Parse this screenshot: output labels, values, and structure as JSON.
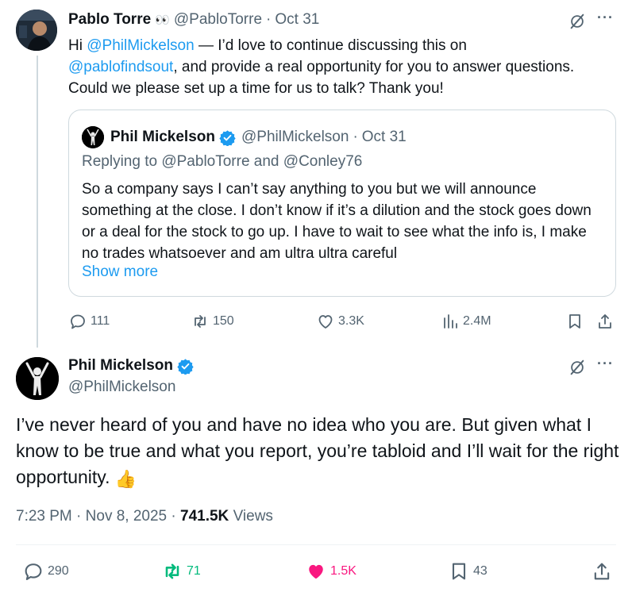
{
  "quoted_tweet": {
    "author_name": "Pablo Torre",
    "author_emoji": "👀",
    "author_handle": "@PabloTorre",
    "separator": "·",
    "date": "Oct 31",
    "text_parts": [
      "Hi ",
      "@PhilMickelson",
      " — I’d love to continue discussing this on ",
      "@pablofindsout",
      ", and provide a real opportunity for you to answer questions. Could we please set up a time for us to talk? Thank you!"
    ],
    "embedded": {
      "author_name": "Phil Mickelson",
      "author_handle": "@PhilMickelson",
      "separator": "·",
      "date": "Oct 31",
      "reply_prefix": "Replying to ",
      "reply_handle_1": "@PabloTorre",
      "reply_and": " and ",
      "reply_handle_2": "@Conley76",
      "text": "So a company says I can’t say anything to you but we will announce something at the close. I don’t know if it’s a dilution and the stock goes down or a deal for the stock to go up. I have to wait to see what the info is, I make no trades whatsoever and am ultra ultra careful",
      "show_more": "Show more"
    },
    "actions": {
      "replies": "111",
      "reposts": "150",
      "likes": "3.3K",
      "views": "2.4M"
    }
  },
  "main_tweet": {
    "author_name": "Phil Mickelson",
    "author_handle": "@PhilMickelson",
    "text": "I’ve never heard of you and have no idea who you are. But given what I know to be true and what you report, you’re tabloid and I’ll wait for the right opportunity.",
    "emoji": "👍",
    "time": "7:23 PM",
    "separator": "·",
    "date": "Nov 8, 2025",
    "separator2": "·",
    "views_count": "741.5K",
    "views_label": "Views",
    "actions": {
      "replies": "290",
      "reposts": "71",
      "likes": "1.5K",
      "bookmarks": "43"
    }
  },
  "colors": {
    "link": "#1d9bf0",
    "secondary_text": "#536471",
    "repost_active": "#00ba7c",
    "like_active": "#f91880",
    "verified": "#1d9bf0"
  },
  "icons": [
    "grok-icon",
    "more-icon",
    "verified-badge-icon",
    "reply-icon",
    "repost-icon",
    "like-icon",
    "views-icon",
    "bookmark-icon",
    "share-icon"
  ],
  "more_glyph": "···"
}
